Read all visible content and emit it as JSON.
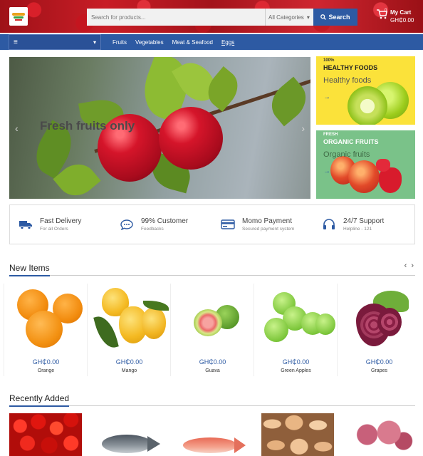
{
  "header": {
    "search_placeholder": "Search for products...",
    "category_select": "All Categories",
    "search_button": "Search",
    "cart_label": "My Cart",
    "cart_total": "GH₵0.00",
    "cart_count": "0"
  },
  "nav": {
    "links": [
      "Fruits",
      "Vegetables",
      "Meat & Seafood",
      "Eggs"
    ]
  },
  "hero": {
    "title": "Fresh fruits only"
  },
  "promos": [
    {
      "tag": "100%",
      "heading": "HEALTHY FOODS",
      "subtitle": "Healthy foods",
      "arrow": "→"
    },
    {
      "tag": "FRESH",
      "heading": "ORGANIC FRUITS",
      "subtitle": "Organic fruits",
      "arrow": "→"
    }
  ],
  "features": [
    {
      "icon": "truck-icon",
      "title": "Fast Delivery",
      "sub": "For all Orders"
    },
    {
      "icon": "chat-icon",
      "title": "99% Customer",
      "sub": "Feedbacks"
    },
    {
      "icon": "card-icon",
      "title": "Momo Payment",
      "sub": "Secured payment system"
    },
    {
      "icon": "headset-icon",
      "title": "24/7 Support",
      "sub": "Helpline - 121"
    }
  ],
  "new_items": {
    "title": "New Items",
    "products": [
      {
        "name": "Orange",
        "price": "GH₵0.00"
      },
      {
        "name": "Mango",
        "price": "GH₵0.00"
      },
      {
        "name": "Guava",
        "price": "GH₵0.00"
      },
      {
        "name": "Green Apples",
        "price": "GH₵0.00"
      },
      {
        "name": "Grapes",
        "price": "GH₵0.00"
      }
    ]
  },
  "recently_added": {
    "title": "Recently Added"
  },
  "colors": {
    "primary": "#2d5aa3",
    "promo_yellow": "#fbe23a",
    "promo_green": "#7ac289"
  }
}
